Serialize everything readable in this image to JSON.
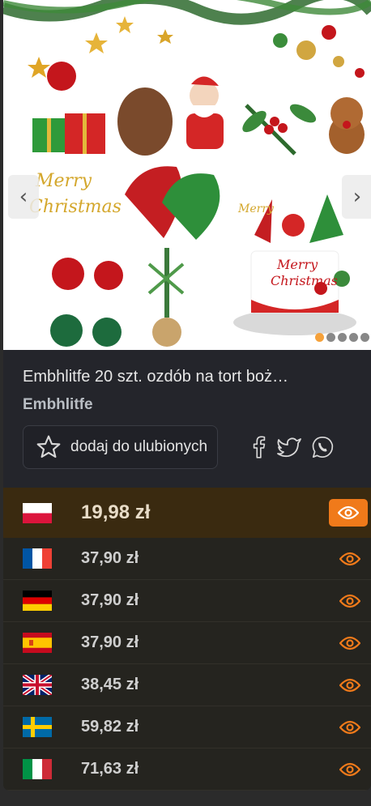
{
  "product": {
    "title": "Embhlitfe 20 szt. ozdób na tort boż…",
    "brand": "Embhlitfe",
    "favorite_label": "dodaj do ulubionych"
  },
  "gallery": {
    "prev_label": "‹",
    "next_label": "›",
    "image_count": 5,
    "active_index": 0,
    "topper_text_1": "Merry",
    "topper_text_2": "Christmas",
    "cake_text_1": "Merry",
    "cake_text_2": "Christmas"
  },
  "colors": {
    "accent": "#f07a1a",
    "best_row_bg": "#3a2a10",
    "card_bg": "#24252b"
  },
  "prices": [
    {
      "country": "Poland",
      "flag": "flag-pl",
      "price": "19,98 zł",
      "best": true
    },
    {
      "country": "France",
      "flag": "flag-fr",
      "price": "37,90 zł"
    },
    {
      "country": "Germany",
      "flag": "flag-de",
      "price": "37,90 zł"
    },
    {
      "country": "Spain",
      "flag": "flag-es",
      "price": "37,90 zł"
    },
    {
      "country": "United Kingdom",
      "flag": "flag-gb",
      "price": "38,45 zł"
    },
    {
      "country": "Sweden",
      "flag": "flag-se",
      "price": "59,82 zł"
    },
    {
      "country": "Italy",
      "flag": "flag-it",
      "price": "71,63 zł"
    }
  ]
}
